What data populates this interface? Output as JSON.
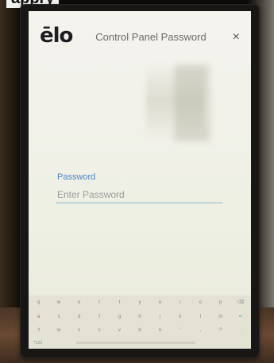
{
  "cropped_text": "appry",
  "app": {
    "logo": "ēlo",
    "title": "Control Panel Password",
    "close_symbol": "×"
  },
  "form": {
    "password_label": "Password",
    "password_placeholder": "Enter Password",
    "password_value": ""
  },
  "keyboard": {
    "row1": [
      "q",
      "w",
      "e",
      "r",
      "t",
      "y",
      "u",
      "i",
      "o",
      "p",
      "⌫"
    ],
    "row2": [
      "a",
      "s",
      "d",
      "f",
      "g",
      "h",
      "j",
      "k",
      "l",
      "m",
      "↵"
    ],
    "row3": [
      "⇧",
      "w",
      "x",
      "c",
      "v",
      "b",
      "n",
      "'",
      ",",
      "?",
      "."
    ],
    "bottom_left": "?123"
  },
  "colors": {
    "accent": "#4b86c6",
    "underline": "#8fb3dc"
  }
}
